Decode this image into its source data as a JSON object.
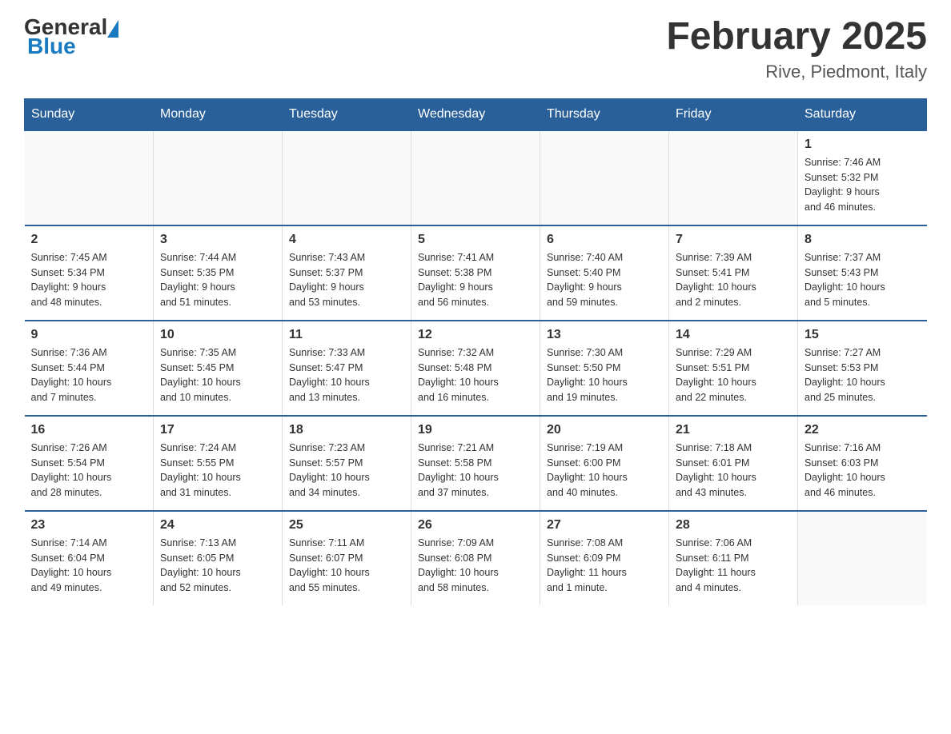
{
  "header": {
    "logo": {
      "text1": "General",
      "text2": "Blue"
    },
    "title": "February 2025",
    "subtitle": "Rive, Piedmont, Italy"
  },
  "days_of_week": [
    "Sunday",
    "Monday",
    "Tuesday",
    "Wednesday",
    "Thursday",
    "Friday",
    "Saturday"
  ],
  "weeks": [
    {
      "days": [
        {
          "num": "",
          "info": ""
        },
        {
          "num": "",
          "info": ""
        },
        {
          "num": "",
          "info": ""
        },
        {
          "num": "",
          "info": ""
        },
        {
          "num": "",
          "info": ""
        },
        {
          "num": "",
          "info": ""
        },
        {
          "num": "1",
          "info": "Sunrise: 7:46 AM\nSunset: 5:32 PM\nDaylight: 9 hours\nand 46 minutes."
        }
      ]
    },
    {
      "days": [
        {
          "num": "2",
          "info": "Sunrise: 7:45 AM\nSunset: 5:34 PM\nDaylight: 9 hours\nand 48 minutes."
        },
        {
          "num": "3",
          "info": "Sunrise: 7:44 AM\nSunset: 5:35 PM\nDaylight: 9 hours\nand 51 minutes."
        },
        {
          "num": "4",
          "info": "Sunrise: 7:43 AM\nSunset: 5:37 PM\nDaylight: 9 hours\nand 53 minutes."
        },
        {
          "num": "5",
          "info": "Sunrise: 7:41 AM\nSunset: 5:38 PM\nDaylight: 9 hours\nand 56 minutes."
        },
        {
          "num": "6",
          "info": "Sunrise: 7:40 AM\nSunset: 5:40 PM\nDaylight: 9 hours\nand 59 minutes."
        },
        {
          "num": "7",
          "info": "Sunrise: 7:39 AM\nSunset: 5:41 PM\nDaylight: 10 hours\nand 2 minutes."
        },
        {
          "num": "8",
          "info": "Sunrise: 7:37 AM\nSunset: 5:43 PM\nDaylight: 10 hours\nand 5 minutes."
        }
      ]
    },
    {
      "days": [
        {
          "num": "9",
          "info": "Sunrise: 7:36 AM\nSunset: 5:44 PM\nDaylight: 10 hours\nand 7 minutes."
        },
        {
          "num": "10",
          "info": "Sunrise: 7:35 AM\nSunset: 5:45 PM\nDaylight: 10 hours\nand 10 minutes."
        },
        {
          "num": "11",
          "info": "Sunrise: 7:33 AM\nSunset: 5:47 PM\nDaylight: 10 hours\nand 13 minutes."
        },
        {
          "num": "12",
          "info": "Sunrise: 7:32 AM\nSunset: 5:48 PM\nDaylight: 10 hours\nand 16 minutes."
        },
        {
          "num": "13",
          "info": "Sunrise: 7:30 AM\nSunset: 5:50 PM\nDaylight: 10 hours\nand 19 minutes."
        },
        {
          "num": "14",
          "info": "Sunrise: 7:29 AM\nSunset: 5:51 PM\nDaylight: 10 hours\nand 22 minutes."
        },
        {
          "num": "15",
          "info": "Sunrise: 7:27 AM\nSunset: 5:53 PM\nDaylight: 10 hours\nand 25 minutes."
        }
      ]
    },
    {
      "days": [
        {
          "num": "16",
          "info": "Sunrise: 7:26 AM\nSunset: 5:54 PM\nDaylight: 10 hours\nand 28 minutes."
        },
        {
          "num": "17",
          "info": "Sunrise: 7:24 AM\nSunset: 5:55 PM\nDaylight: 10 hours\nand 31 minutes."
        },
        {
          "num": "18",
          "info": "Sunrise: 7:23 AM\nSunset: 5:57 PM\nDaylight: 10 hours\nand 34 minutes."
        },
        {
          "num": "19",
          "info": "Sunrise: 7:21 AM\nSunset: 5:58 PM\nDaylight: 10 hours\nand 37 minutes."
        },
        {
          "num": "20",
          "info": "Sunrise: 7:19 AM\nSunset: 6:00 PM\nDaylight: 10 hours\nand 40 minutes."
        },
        {
          "num": "21",
          "info": "Sunrise: 7:18 AM\nSunset: 6:01 PM\nDaylight: 10 hours\nand 43 minutes."
        },
        {
          "num": "22",
          "info": "Sunrise: 7:16 AM\nSunset: 6:03 PM\nDaylight: 10 hours\nand 46 minutes."
        }
      ]
    },
    {
      "days": [
        {
          "num": "23",
          "info": "Sunrise: 7:14 AM\nSunset: 6:04 PM\nDaylight: 10 hours\nand 49 minutes."
        },
        {
          "num": "24",
          "info": "Sunrise: 7:13 AM\nSunset: 6:05 PM\nDaylight: 10 hours\nand 52 minutes."
        },
        {
          "num": "25",
          "info": "Sunrise: 7:11 AM\nSunset: 6:07 PM\nDaylight: 10 hours\nand 55 minutes."
        },
        {
          "num": "26",
          "info": "Sunrise: 7:09 AM\nSunset: 6:08 PM\nDaylight: 10 hours\nand 58 minutes."
        },
        {
          "num": "27",
          "info": "Sunrise: 7:08 AM\nSunset: 6:09 PM\nDaylight: 11 hours\nand 1 minute."
        },
        {
          "num": "28",
          "info": "Sunrise: 7:06 AM\nSunset: 6:11 PM\nDaylight: 11 hours\nand 4 minutes."
        },
        {
          "num": "",
          "info": ""
        }
      ]
    }
  ]
}
